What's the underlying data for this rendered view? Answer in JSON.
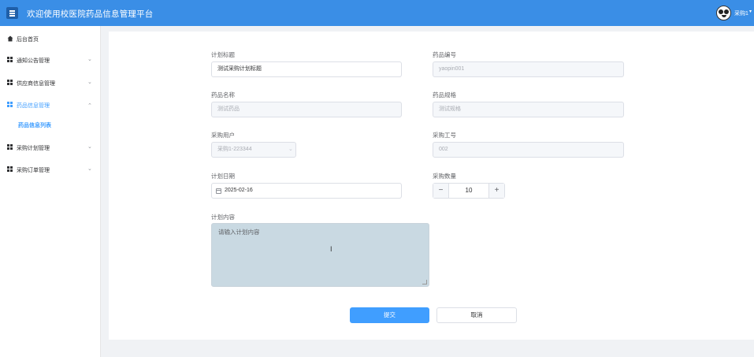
{
  "header": {
    "title": "欢迎使用校医院药品信息管理平台",
    "user": "采购1"
  },
  "sidebar": {
    "items": [
      {
        "label": "后台首页",
        "icon": "home-icon"
      },
      {
        "label": "通知公告管理",
        "icon": "grid-icon"
      },
      {
        "label": "供应商信息管理",
        "icon": "grid-icon"
      },
      {
        "label": "药品信息管理",
        "icon": "grid-icon"
      },
      {
        "label": "采购计划管理",
        "icon": "grid-icon"
      },
      {
        "label": "采购订单管理",
        "icon": "grid-icon"
      }
    ],
    "sub_item": "药品信息列表"
  },
  "form": {
    "plan_title": {
      "label": "计划标题",
      "value": "测试采购计划标题"
    },
    "drug_code": {
      "label": "药品编号",
      "value": "yaopin001"
    },
    "drug_name": {
      "label": "药品名称",
      "value": "测试药品"
    },
    "drug_spec": {
      "label": "药品规格",
      "value": "测试规格"
    },
    "buyer": {
      "label": "采购用户",
      "value": "采购1-223344"
    },
    "buyer_no": {
      "label": "采购工号",
      "value": "002"
    },
    "plan_date": {
      "label": "计划日期",
      "value": "2025-02-16"
    },
    "quantity": {
      "label": "采购数量",
      "value": "10",
      "minus": "−",
      "plus": "+"
    },
    "content": {
      "label": "计划内容",
      "placeholder": "请输入计划内容"
    },
    "submit": "提交",
    "cancel": "取消"
  },
  "colors": {
    "header": "#3a8ee6",
    "accent": "#409eff",
    "textarea_bg": "#c9d9e2"
  }
}
